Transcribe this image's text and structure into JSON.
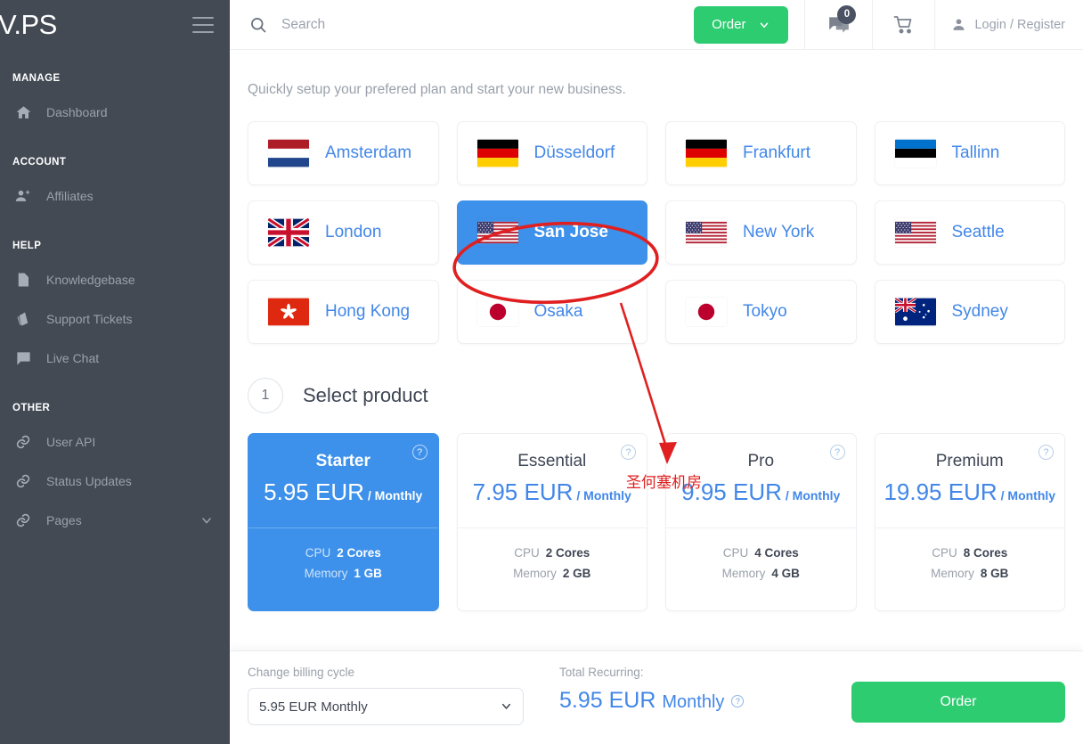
{
  "sidebar": {
    "brand": "V.PS",
    "menu_icon": "hamburger-icon",
    "groups": [
      {
        "title": "MANAGE",
        "items": [
          {
            "label": "Dashboard",
            "icon": "home-icon"
          }
        ]
      },
      {
        "title": "ACCOUNT",
        "items": [
          {
            "label": "Affiliates",
            "icon": "users-add-icon"
          }
        ]
      },
      {
        "title": "HELP",
        "items": [
          {
            "label": "Knowledgebase",
            "icon": "document-icon"
          },
          {
            "label": "Support Tickets",
            "icon": "ticket-icon"
          },
          {
            "label": "Live Chat",
            "icon": "chat-icon"
          }
        ]
      },
      {
        "title": "OTHER",
        "items": [
          {
            "label": "User API",
            "icon": "link-icon"
          },
          {
            "label": "Status Updates",
            "icon": "link-icon"
          },
          {
            "label": "Pages",
            "icon": "link-icon",
            "chevron": "chevron-down-icon"
          }
        ]
      }
    ]
  },
  "topbar": {
    "search_placeholder": "Search",
    "search_value": "",
    "order_label": "Order",
    "order_chevron": "chevron-down-icon",
    "message_badge": "0",
    "login_label": "Login / Register"
  },
  "page": {
    "subtitle": "Quickly setup your prefered plan and start your new business."
  },
  "locations": [
    {
      "name": "Amsterdam",
      "flag": "nl",
      "selected": false
    },
    {
      "name": "Düsseldorf",
      "flag": "de",
      "selected": false
    },
    {
      "name": "Frankfurt",
      "flag": "de",
      "selected": false
    },
    {
      "name": "Tallinn",
      "flag": "ee",
      "selected": false
    },
    {
      "name": "London",
      "flag": "gb",
      "selected": false
    },
    {
      "name": "San Jose",
      "flag": "us",
      "selected": true
    },
    {
      "name": "New York",
      "flag": "us",
      "selected": false
    },
    {
      "name": "Seattle",
      "flag": "us",
      "selected": false
    },
    {
      "name": "Hong Kong",
      "flag": "hk",
      "selected": false
    },
    {
      "name": "Osaka",
      "flag": "jp",
      "selected": false
    },
    {
      "name": "Tokyo",
      "flag": "jp",
      "selected": false
    },
    {
      "name": "Sydney",
      "flag": "au",
      "selected": false
    }
  ],
  "step": {
    "number": "1",
    "title": "Select product"
  },
  "products": [
    {
      "name": "Starter",
      "price": "5.95 EUR",
      "period": "/ Monthly",
      "selected": true,
      "specs": [
        {
          "k": "CPU",
          "v": "2 Cores"
        },
        {
          "k": "Memory",
          "v": "1 GB"
        }
      ]
    },
    {
      "name": "Essential",
      "price": "7.95 EUR",
      "period": "/ Monthly",
      "selected": false,
      "specs": [
        {
          "k": "CPU",
          "v": "2 Cores"
        },
        {
          "k": "Memory",
          "v": "2 GB"
        }
      ]
    },
    {
      "name": "Pro",
      "price": "9.95 EUR",
      "period": "/ Monthly",
      "selected": false,
      "specs": [
        {
          "k": "CPU",
          "v": "4 Cores"
        },
        {
          "k": "Memory",
          "v": "4 GB"
        }
      ]
    },
    {
      "name": "Premium",
      "price": "19.95 EUR",
      "period": "/ Monthly",
      "selected": false,
      "specs": [
        {
          "k": "CPU",
          "v": "8 Cores"
        },
        {
          "k": "Memory",
          "v": "8 GB"
        }
      ]
    }
  ],
  "bottom_bar": {
    "billing_label": "Change billing cycle",
    "billing_selected": "5.95 EUR Monthly",
    "billing_options": [
      "5.95 EUR Monthly"
    ],
    "total_label": "Total Recurring:",
    "total_amount": "5.95 EUR",
    "total_period": "Monthly",
    "order_label": "Order"
  },
  "annotation": {
    "text": "圣何塞机房",
    "color": "#e02020",
    "shapes": [
      "ellipse-highlight-san-jose",
      "arrow-to-label"
    ]
  },
  "colors": {
    "sidebar_bg": "#434a54",
    "accent_blue": "#4287e8",
    "selected_blue": "#3d91ea",
    "green": "#2ecc71",
    "annotation_red": "#e02020"
  }
}
